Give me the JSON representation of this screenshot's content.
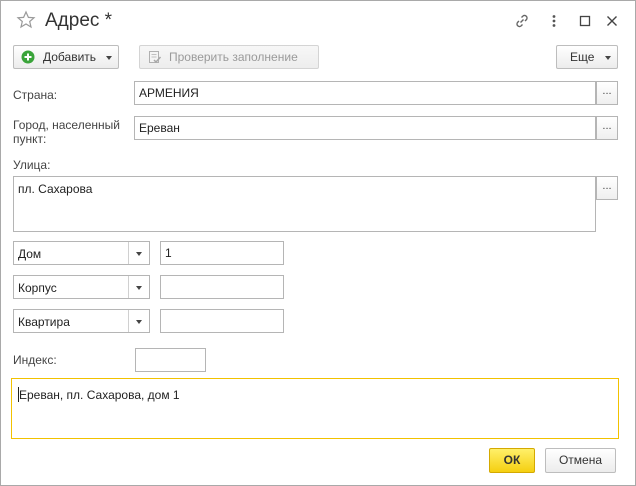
{
  "window": {
    "title": "Адрес *"
  },
  "toolbar": {
    "add_label": "Добавить",
    "check_label": "Проверить заполнение",
    "more_label": "Еще"
  },
  "form": {
    "country": {
      "label": "Страна:",
      "value": "АРМЕНИЯ",
      "select_label": "..."
    },
    "city": {
      "label_line1": "Город, населенный",
      "label_line2": "пункт:",
      "value": "Ереван",
      "select_label": "..."
    },
    "street": {
      "label": "Улица:",
      "value": "пл. Сахарова",
      "select_label": "..."
    },
    "house": {
      "type": "Дом",
      "value": "1"
    },
    "building": {
      "type": "Корпус",
      "value": ""
    },
    "apartment": {
      "type": "Квартира",
      "value": ""
    },
    "postcode": {
      "label": "Индекс:",
      "value": ""
    }
  },
  "summary": {
    "text": "Ереван, пл. Сахарова, дом 1"
  },
  "footer": {
    "ok_label": "ОК",
    "cancel_label": "Отмена"
  },
  "colors": {
    "accent_yellow": "#f5cf10",
    "focus_border": "#f2c200",
    "add_icon_green": "#3aa43a"
  }
}
